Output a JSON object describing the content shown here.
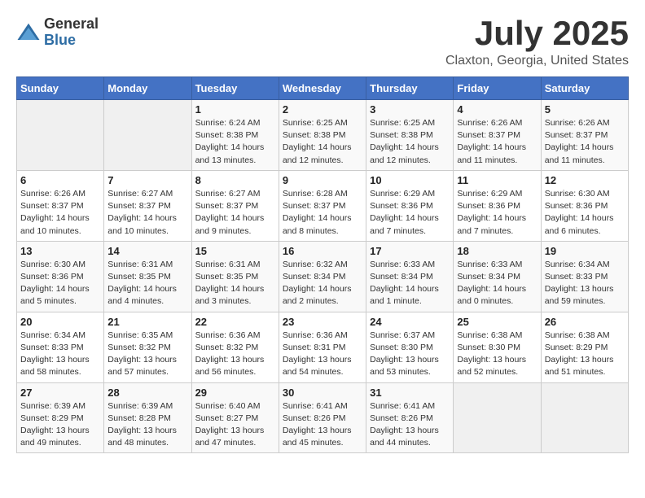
{
  "logo": {
    "general": "General",
    "blue": "Blue"
  },
  "title": "July 2025",
  "location": "Claxton, Georgia, United States",
  "days_of_week": [
    "Sunday",
    "Monday",
    "Tuesday",
    "Wednesday",
    "Thursday",
    "Friday",
    "Saturday"
  ],
  "weeks": [
    [
      {
        "day": "",
        "info": ""
      },
      {
        "day": "",
        "info": ""
      },
      {
        "day": "1",
        "info": "Sunrise: 6:24 AM\nSunset: 8:38 PM\nDaylight: 14 hours and 13 minutes."
      },
      {
        "day": "2",
        "info": "Sunrise: 6:25 AM\nSunset: 8:38 PM\nDaylight: 14 hours and 12 minutes."
      },
      {
        "day": "3",
        "info": "Sunrise: 6:25 AM\nSunset: 8:38 PM\nDaylight: 14 hours and 12 minutes."
      },
      {
        "day": "4",
        "info": "Sunrise: 6:26 AM\nSunset: 8:37 PM\nDaylight: 14 hours and 11 minutes."
      },
      {
        "day": "5",
        "info": "Sunrise: 6:26 AM\nSunset: 8:37 PM\nDaylight: 14 hours and 11 minutes."
      }
    ],
    [
      {
        "day": "6",
        "info": "Sunrise: 6:26 AM\nSunset: 8:37 PM\nDaylight: 14 hours and 10 minutes."
      },
      {
        "day": "7",
        "info": "Sunrise: 6:27 AM\nSunset: 8:37 PM\nDaylight: 14 hours and 10 minutes."
      },
      {
        "day": "8",
        "info": "Sunrise: 6:27 AM\nSunset: 8:37 PM\nDaylight: 14 hours and 9 minutes."
      },
      {
        "day": "9",
        "info": "Sunrise: 6:28 AM\nSunset: 8:37 PM\nDaylight: 14 hours and 8 minutes."
      },
      {
        "day": "10",
        "info": "Sunrise: 6:29 AM\nSunset: 8:36 PM\nDaylight: 14 hours and 7 minutes."
      },
      {
        "day": "11",
        "info": "Sunrise: 6:29 AM\nSunset: 8:36 PM\nDaylight: 14 hours and 7 minutes."
      },
      {
        "day": "12",
        "info": "Sunrise: 6:30 AM\nSunset: 8:36 PM\nDaylight: 14 hours and 6 minutes."
      }
    ],
    [
      {
        "day": "13",
        "info": "Sunrise: 6:30 AM\nSunset: 8:36 PM\nDaylight: 14 hours and 5 minutes."
      },
      {
        "day": "14",
        "info": "Sunrise: 6:31 AM\nSunset: 8:35 PM\nDaylight: 14 hours and 4 minutes."
      },
      {
        "day": "15",
        "info": "Sunrise: 6:31 AM\nSunset: 8:35 PM\nDaylight: 14 hours and 3 minutes."
      },
      {
        "day": "16",
        "info": "Sunrise: 6:32 AM\nSunset: 8:34 PM\nDaylight: 14 hours and 2 minutes."
      },
      {
        "day": "17",
        "info": "Sunrise: 6:33 AM\nSunset: 8:34 PM\nDaylight: 14 hours and 1 minute."
      },
      {
        "day": "18",
        "info": "Sunrise: 6:33 AM\nSunset: 8:34 PM\nDaylight: 14 hours and 0 minutes."
      },
      {
        "day": "19",
        "info": "Sunrise: 6:34 AM\nSunset: 8:33 PM\nDaylight: 13 hours and 59 minutes."
      }
    ],
    [
      {
        "day": "20",
        "info": "Sunrise: 6:34 AM\nSunset: 8:33 PM\nDaylight: 13 hours and 58 minutes."
      },
      {
        "day": "21",
        "info": "Sunrise: 6:35 AM\nSunset: 8:32 PM\nDaylight: 13 hours and 57 minutes."
      },
      {
        "day": "22",
        "info": "Sunrise: 6:36 AM\nSunset: 8:32 PM\nDaylight: 13 hours and 56 minutes."
      },
      {
        "day": "23",
        "info": "Sunrise: 6:36 AM\nSunset: 8:31 PM\nDaylight: 13 hours and 54 minutes."
      },
      {
        "day": "24",
        "info": "Sunrise: 6:37 AM\nSunset: 8:30 PM\nDaylight: 13 hours and 53 minutes."
      },
      {
        "day": "25",
        "info": "Sunrise: 6:38 AM\nSunset: 8:30 PM\nDaylight: 13 hours and 52 minutes."
      },
      {
        "day": "26",
        "info": "Sunrise: 6:38 AM\nSunset: 8:29 PM\nDaylight: 13 hours and 51 minutes."
      }
    ],
    [
      {
        "day": "27",
        "info": "Sunrise: 6:39 AM\nSunset: 8:29 PM\nDaylight: 13 hours and 49 minutes."
      },
      {
        "day": "28",
        "info": "Sunrise: 6:39 AM\nSunset: 8:28 PM\nDaylight: 13 hours and 48 minutes."
      },
      {
        "day": "29",
        "info": "Sunrise: 6:40 AM\nSunset: 8:27 PM\nDaylight: 13 hours and 47 minutes."
      },
      {
        "day": "30",
        "info": "Sunrise: 6:41 AM\nSunset: 8:26 PM\nDaylight: 13 hours and 45 minutes."
      },
      {
        "day": "31",
        "info": "Sunrise: 6:41 AM\nSunset: 8:26 PM\nDaylight: 13 hours and 44 minutes."
      },
      {
        "day": "",
        "info": ""
      },
      {
        "day": "",
        "info": ""
      }
    ]
  ]
}
